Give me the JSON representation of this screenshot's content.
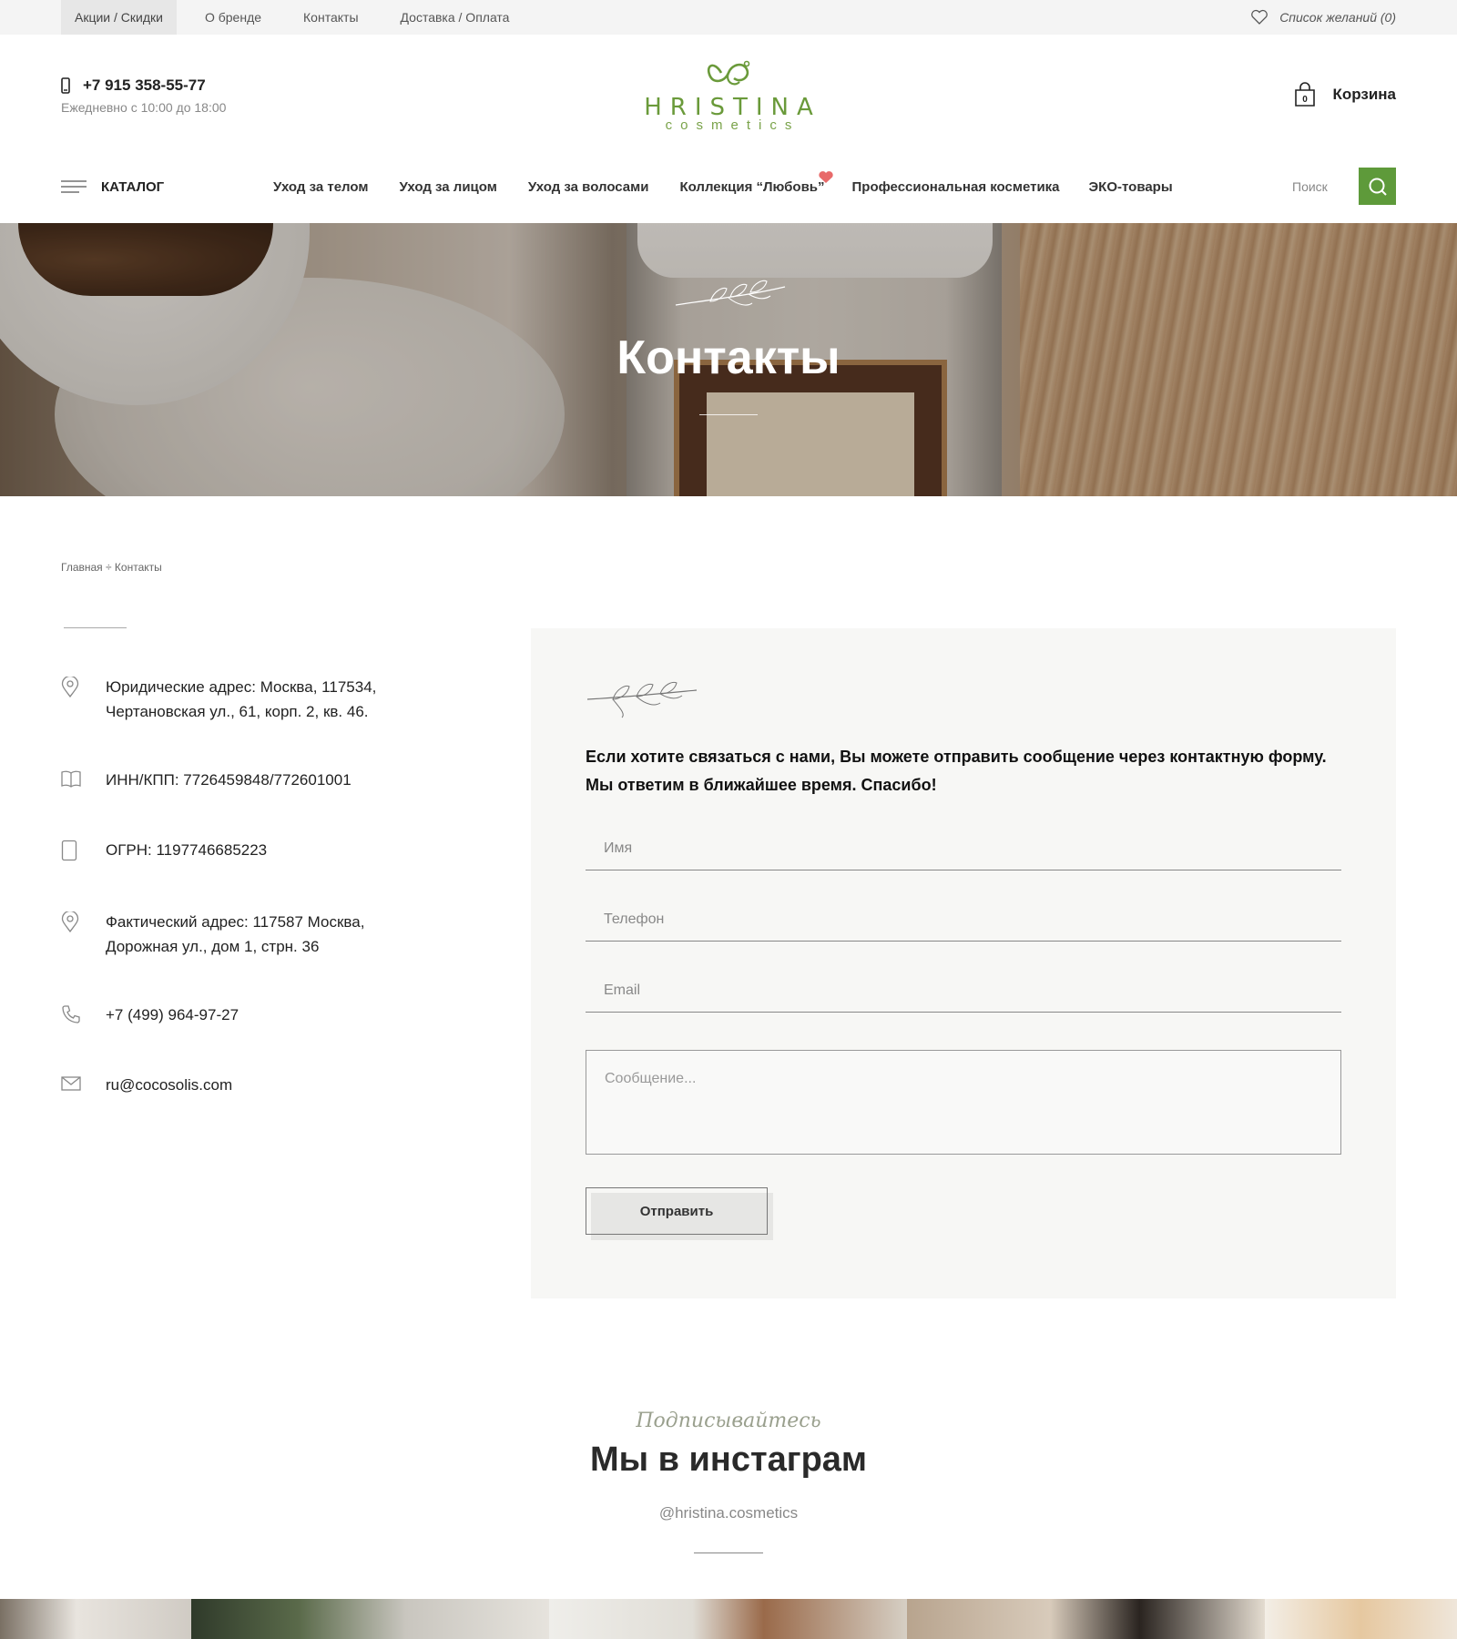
{
  "topbar": {
    "links": [
      "Акции / Скидки",
      "О бренде",
      "Контакты",
      "Доставка / Оплата"
    ],
    "wishlist": "Список желаний (0)"
  },
  "header": {
    "phone": "+7 915 358-55-77",
    "hours": "Ежедневно с 10:00 до 18:00",
    "logo_brand": "HRISTINA",
    "logo_sub": "cosmetics",
    "cart_label": "Корзина",
    "cart_count": "0"
  },
  "nav": {
    "catalog": "КАТАЛОГ",
    "items": [
      "Уход за телом",
      "Уход за лицом",
      "Уход за волосами",
      "Коллекция “Любовь”",
      "Профессиональная косметика",
      "ЭКО-товары"
    ],
    "search_placeholder": "Поиск"
  },
  "hero": {
    "title": "Контакты"
  },
  "breadcrumb": "Главная ÷ Контакты",
  "contacts": [
    {
      "icon": "map-pin-icon",
      "text": "Юридические адрес: Москва, 117534,\nЧертановская ул., 61, корп. 2, кв. 46."
    },
    {
      "icon": "book-icon",
      "text": "ИНН/КПП: 7726459848/772601001"
    },
    {
      "icon": "tablet-icon",
      "text": "ОГРН: 1197746685223"
    },
    {
      "icon": "map-pin-icon",
      "text": "Фактический адрес: 117587 Москва,\nДорожная ул., дом 1, стрн. 36"
    },
    {
      "icon": "phone-icon",
      "text": "+7 (499) 964-97-27"
    },
    {
      "icon": "mail-icon",
      "text": "ru@cocosolis.com"
    }
  ],
  "form": {
    "intro": "Если хотите связаться с нами, Вы можете отправить сообщение через контактную форму. Мы ответим в ближайшее время. Спасибо!",
    "name_placeholder": "Имя",
    "phone_placeholder": "Телефон",
    "email_placeholder": "Email",
    "message_placeholder": "Сообщение...",
    "submit": "Отправить"
  },
  "instagram": {
    "script": "Подписывайтесь",
    "title": "Мы в инстаграм",
    "handle": "@hristina.cosmetics"
  },
  "colors": {
    "accent": "#5e9a3a",
    "card_bg": "#f7f7f5",
    "topbar_bg": "#f4f4f4"
  }
}
